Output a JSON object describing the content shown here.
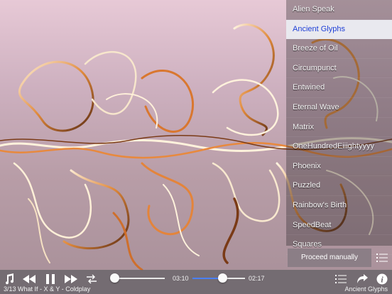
{
  "preset_menu": {
    "items": [
      {
        "label": "Alien Speak",
        "selected": false
      },
      {
        "label": "Ancient Glyphs",
        "selected": true
      },
      {
        "label": "Breeze of Oil",
        "selected": false
      },
      {
        "label": "Circumpunct",
        "selected": false
      },
      {
        "label": "Entwined",
        "selected": false
      },
      {
        "label": "Eternal Wave",
        "selected": false
      },
      {
        "label": "Matrix",
        "selected": false
      },
      {
        "label": "OneHundredEiiightyyyy",
        "selected": false
      },
      {
        "label": "Phoenix",
        "selected": false
      },
      {
        "label": "Puzzled",
        "selected": false
      },
      {
        "label": "Rainbow's Birth",
        "selected": false
      },
      {
        "label": "SpeedBeat",
        "selected": false
      },
      {
        "label": "Squares",
        "selected": false
      }
    ],
    "proceed_label": "Proceed manually"
  },
  "player": {
    "elapsed": "03:10",
    "remaining": "02:17",
    "track_info": "3/13 What If - X & Y - Coldplay",
    "current_preset": "Ancient Glyphs",
    "progress": 0.58,
    "volume": 0
  },
  "colors": {
    "accent": "#1e3fd6",
    "slider_fill": "#4a80ff",
    "menu_selected_bg": "#e9e9ef"
  },
  "icons": [
    "music-note-icon",
    "rewind-icon",
    "pause-icon",
    "fast-forward-icon",
    "repeat-icon",
    "list-icon",
    "share-icon",
    "info-icon"
  ]
}
